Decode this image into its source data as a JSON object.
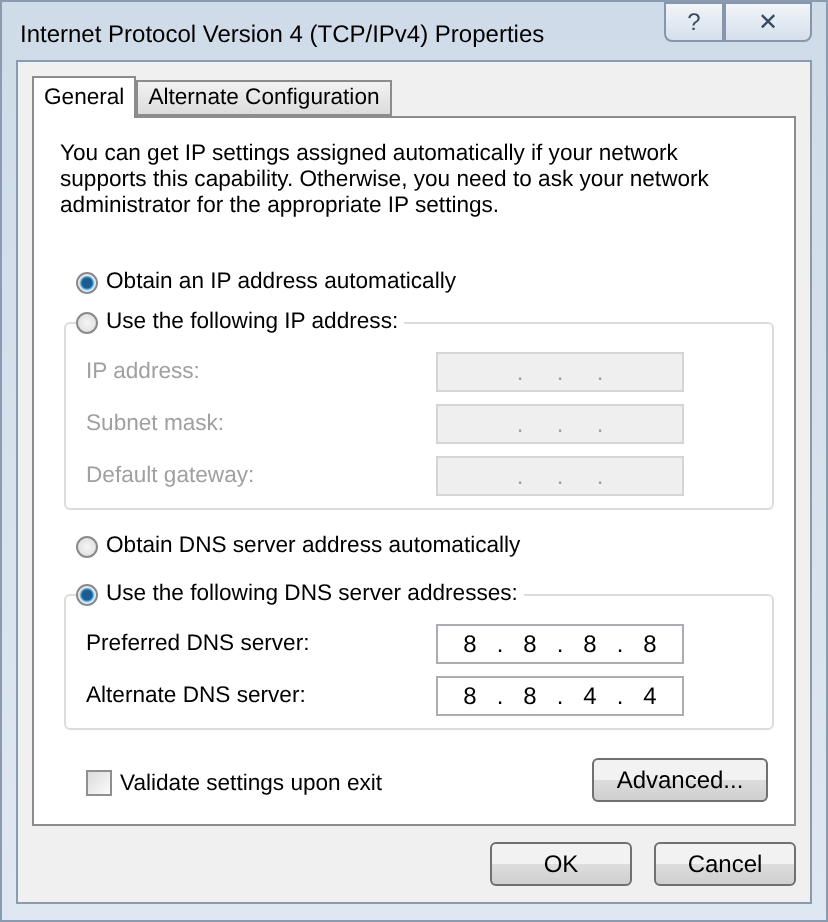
{
  "window": {
    "title": "Internet Protocol Version 4 (TCP/IPv4) Properties",
    "help": "?",
    "close": "✕"
  },
  "tabs": [
    {
      "label": "General",
      "selected": true
    },
    {
      "label": "Alternate Configuration",
      "selected": false
    }
  ],
  "intro": "You can get IP settings assigned automatically if your network supports this capability. Otherwise, you need to ask your network administrator for the appropriate IP settings.",
  "ip_auto": {
    "label": "Obtain an IP address automatically",
    "selected": true
  },
  "ip_manual": {
    "label": "Use the following IP address:",
    "selected": false,
    "disabled": true,
    "fields": [
      {
        "label": "IP address:",
        "value": ".     .     ."
      },
      {
        "label": "Subnet mask:",
        "value": ".     .     ."
      },
      {
        "label": "Default gateway:",
        "value": ".     .     ."
      }
    ]
  },
  "dns_auto": {
    "label": "Obtain DNS server address automatically",
    "selected": false
  },
  "dns_manual": {
    "label": "Use the following DNS server addresses:",
    "selected": true,
    "disabled": false,
    "fields": [
      {
        "label": "Preferred DNS server:",
        "value": "8   .   8   .   8   .   8"
      },
      {
        "label": "Alternate DNS server:",
        "value": "8   .   8   .   4   .   4"
      }
    ]
  },
  "validate": {
    "label": "Validate settings upon exit",
    "checked": false
  },
  "buttons": {
    "advanced": "Advanced...",
    "ok": "OK",
    "cancel": "Cancel"
  }
}
